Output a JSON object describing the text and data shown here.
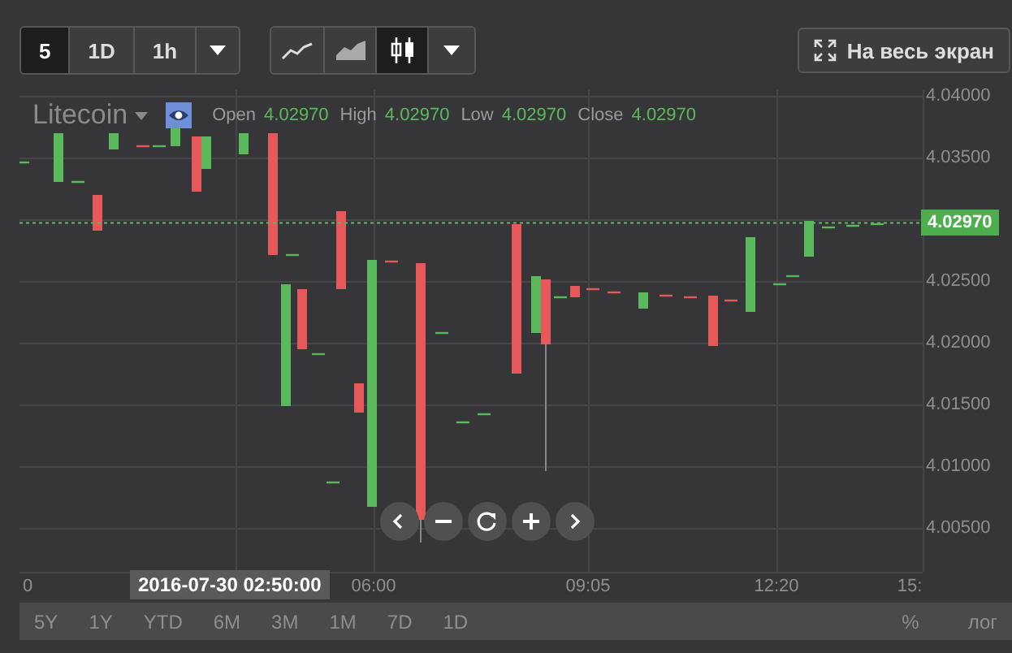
{
  "toolbar": {
    "intervals": [
      {
        "label": "5",
        "selected": true
      },
      {
        "label": "1D",
        "selected": false
      },
      {
        "label": "1h",
        "selected": false
      }
    ],
    "chart_types": [
      {
        "kind": "line",
        "selected": false
      },
      {
        "kind": "area",
        "selected": false
      },
      {
        "kind": "candles",
        "selected": true
      }
    ],
    "fullscreen": "На весь экран"
  },
  "legend": {
    "symbol": "Litecoin",
    "fields": [
      {
        "label": "Open",
        "value": "4.02970"
      },
      {
        "label": "High",
        "value": "4.02970"
      },
      {
        "label": "Low",
        "value": "4.02970"
      },
      {
        "label": "Close",
        "value": "4.02970"
      }
    ]
  },
  "price_axis": {
    "ticks": [
      "4.04000",
      "4.03500",
      "4.02500",
      "4.02000",
      "4.01500",
      "4.01000",
      "4.00500"
    ],
    "current": "4.02970"
  },
  "time_axis": {
    "labels": [
      "0",
      "06:00",
      "09:05",
      "12:20",
      "15:"
    ],
    "crosshair": "2016-07-30 02:50:00"
  },
  "ranges": [
    "5Y",
    "1Y",
    "YTD",
    "6M",
    "3M",
    "1M",
    "7D",
    "1D"
  ],
  "scale_options": [
    "%",
    "лог"
  ]
}
